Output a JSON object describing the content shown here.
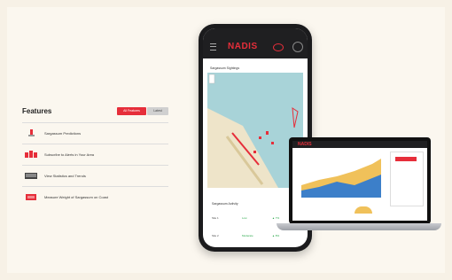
{
  "features": {
    "title": "Features",
    "tabs": [
      {
        "label": "All Features"
      },
      {
        "label": "Latest"
      }
    ],
    "items": [
      {
        "label": "Sargassum Predictions",
        "icon": "predictions-icon"
      },
      {
        "label": "Subscribe to Alerts in Your Area",
        "icon": "alerts-icon"
      },
      {
        "label": "View Statistics and Trends",
        "icon": "statistics-icon"
      },
      {
        "label": "Measure Weight of Sargassum on Coast",
        "icon": "weight-icon"
      }
    ]
  },
  "phone": {
    "brand": "NADIS",
    "map_title": "Sargassum Sightings",
    "card_title": "Sargassum Activity",
    "rows": [
      {
        "site": "Site 1",
        "status": "Low",
        "change": "▲ 7%"
      },
      {
        "site": "Site 2",
        "status": "Moderate",
        "change": "▲ 8%"
      }
    ]
  },
  "laptop": {
    "brand": "NADIS"
  },
  "colors": {
    "accent": "#e62e3a",
    "background": "#f7f1e6"
  }
}
